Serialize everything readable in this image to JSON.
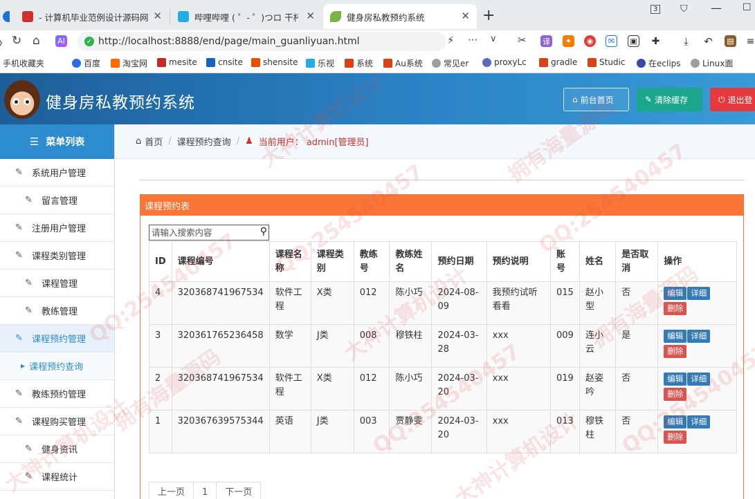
{
  "browser": {
    "tabs": [
      {
        "label": "- 计算机毕业范例设计源码网",
        "color": "#d32f2f"
      },
      {
        "label": "哔哩哔哩 ( ゜- ゜)つロ 干杯~-b",
        "color": "#23ade5"
      },
      {
        "label": "健身房私教预约系统",
        "color": "#4caf50"
      }
    ],
    "url": "http://localhost:8888/end/page/main_guanliyuan.html",
    "tab_count": "3",
    "bookmarks": [
      "手机收藏夹",
      "百度",
      "淘宝网",
      "mesite",
      "cnsite",
      "shensite",
      "乐视",
      "系统",
      "Au系统",
      "常见er",
      "proxyLc",
      "gradle",
      "Studic",
      "在eclips",
      "Linux面"
    ]
  },
  "header": {
    "title": "健身房私教预约系统",
    "home_button": "前台首页",
    "clear_cache_button": "清除缓存",
    "logout_button": "退出登"
  },
  "sidebar": {
    "title": "菜单列表",
    "items": [
      {
        "label": "系统用户管理",
        "level": 1
      },
      {
        "label": "留言管理",
        "level": 2
      },
      {
        "label": "注册用户管理",
        "level": 1
      },
      {
        "label": "课程类别管理",
        "level": 1
      },
      {
        "label": "课程管理",
        "level": 2
      },
      {
        "label": "教练管理",
        "level": 2
      },
      {
        "label": "课程预约管理",
        "level": 1,
        "active": true
      },
      {
        "label": "课程预约查询",
        "level": 3
      },
      {
        "label": "教练预约管理",
        "level": 1
      },
      {
        "label": "课程购买管理",
        "level": 1
      },
      {
        "label": "健身资讯",
        "level": 2
      },
      {
        "label": "课程统计",
        "level": 2
      }
    ]
  },
  "breadcrumb": {
    "home": "首页",
    "page": "课程预约查询",
    "user_label": "当前用户：",
    "user": "admin[管理员]"
  },
  "panel": {
    "title": "课程预约表",
    "search_placeholder": "请输入搜索内容",
    "columns": [
      "ID",
      "课程编号",
      "课程名称",
      "课程类别",
      "教练号",
      "教练姓名",
      "预约日期",
      "预约说明",
      "账号",
      "姓名",
      "是否取消",
      "操作"
    ],
    "rows": [
      [
        "4",
        "320368741967534",
        "软件工程",
        "X类",
        "012",
        "陈小巧",
        "2024-08-09",
        "我预约试听看看",
        "015",
        "赵小型",
        "否"
      ],
      [
        "3",
        "320361765236458",
        "数学",
        "J类",
        "008",
        "穆铁柱",
        "2024-03-28",
        "xxx",
        "009",
        "连小云",
        "是"
      ],
      [
        "2",
        "320368741967534",
        "软件工程",
        "X类",
        "012",
        "陈小巧",
        "2024-03-20",
        "xxx",
        "019",
        "赵姿吟",
        "否"
      ],
      [
        "1",
        "320367639575344",
        "英语",
        "J类",
        "003",
        "贾静雯",
        "2024-03-20",
        "xxx",
        "013",
        "穆铁柱",
        "否"
      ]
    ],
    "actions": {
      "edit": "编辑",
      "detail": "详细",
      "delete": "删除"
    },
    "pager": {
      "prev": "上一页",
      "page": "1",
      "next": "下一页"
    }
  },
  "watermark": [
    "大神计算机设计",
    "QQ:254540457",
    "拥有海量源码"
  ]
}
